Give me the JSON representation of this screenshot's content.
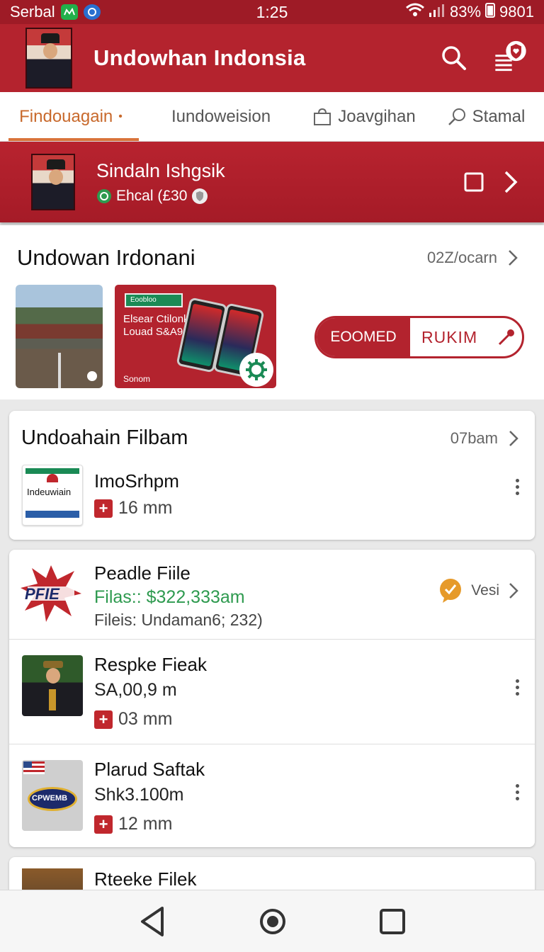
{
  "status_bar": {
    "carrier": "Serbal",
    "time": "1:25",
    "battery": "83%",
    "extra": "9801"
  },
  "app_bar": {
    "title": "Undowhan  Indonsia"
  },
  "tabs": [
    {
      "label": "Findouagain",
      "active": true,
      "dot": "•"
    },
    {
      "label": "Iundoweision"
    },
    {
      "label": "Joavgihan",
      "icon": "bag-icon"
    },
    {
      "label": "Stamal",
      "icon": "search-icon"
    }
  ],
  "banner": {
    "name": "Sindaln Ishgsik",
    "subtitle": "Ehcal (£30"
  },
  "featured": {
    "title": "Undowan Irdonani",
    "meta": "02Z/ocarn",
    "promo": {
      "tag": "Eoobloo",
      "line1": "Elsear Ctilonk",
      "line2": "Louad S&A9",
      "footer": "Sonom"
    },
    "toggle": {
      "on_label": "EOOMED",
      "off_label": "RUKIM"
    }
  },
  "files_card": {
    "title": "Undoahain Filbam",
    "meta": "07bam",
    "item": {
      "thumb_text": "Indeuwiain",
      "title": "ImoSrhpm",
      "size": "16 mm"
    }
  },
  "list": [
    {
      "thumb_text": "PFIE",
      "title": "Peadle Fiile",
      "line1": "Filas:: $322,333am",
      "line2": "Fileis: Undaman6; 232)",
      "badge": "Vesi"
    },
    {
      "title": "Respke Fieak",
      "line1": "SA,00,9 m",
      "size": "03 mm"
    },
    {
      "thumb_text": "CPWEMB",
      "title": "Plarud Saftak",
      "line1": "Shk3.100m",
      "size": "12 mm"
    }
  ],
  "last_item": {
    "title": "Rteeke Filek"
  },
  "colors": {
    "brand": "#b4232e",
    "accent": "#d9733a",
    "success": "#1a8a55",
    "price": "#2e9a4f"
  }
}
